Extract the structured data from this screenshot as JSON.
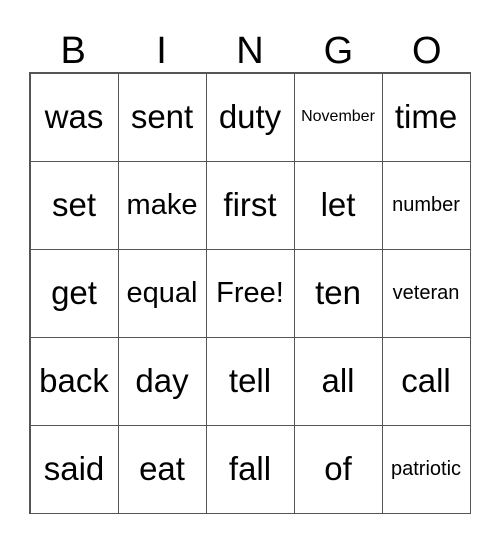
{
  "header": [
    "B",
    "I",
    "N",
    "G",
    "O"
  ],
  "cells": [
    [
      "was",
      "sent",
      "duty",
      "November",
      "time"
    ],
    [
      "set",
      "make",
      "first",
      "let",
      "number"
    ],
    [
      "get",
      "equal",
      "Free!",
      "ten",
      "veteran"
    ],
    [
      "back",
      "day",
      "tell",
      "all",
      "call"
    ],
    [
      "said",
      "eat",
      "fall",
      "of",
      "patriotic"
    ]
  ]
}
